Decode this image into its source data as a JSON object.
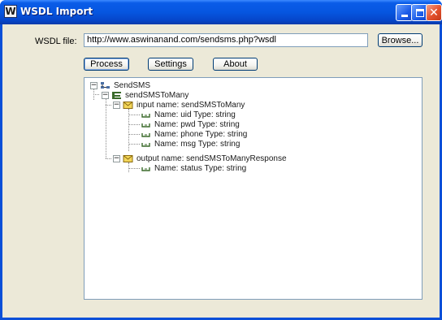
{
  "window": {
    "title": "WSDL Import",
    "app_icon_glyph": "W",
    "controls": [
      "minimize-icon",
      "maximize-icon",
      "close-icon"
    ]
  },
  "form": {
    "wsdl_label": "WSDL file:",
    "wsdl_value": "http://www.aswinanand.com/sendsms.php?wsdl",
    "browse_label": "Browse..."
  },
  "toolbar": {
    "process_label": "Process",
    "settings_label": "Settings",
    "about_label": "About"
  },
  "tree": {
    "root": {
      "label": "SendSMS",
      "icon": "service-icon",
      "expanded": true
    },
    "operation": {
      "label": "sendSMSToMany",
      "icon": "operation-icon",
      "expanded": true
    },
    "input": {
      "label": "input name: sendSMSToMany",
      "icon": "message-icon",
      "expanded": true
    },
    "input_params": [
      {
        "label": "Name: uid Type: string",
        "icon": "param-icon"
      },
      {
        "label": "Name: pwd Type: string",
        "icon": "param-icon"
      },
      {
        "label": "Name: phone Type: string",
        "icon": "param-icon"
      },
      {
        "label": "Name: msg Type: string",
        "icon": "param-icon"
      }
    ],
    "output": {
      "label": "output name: sendSMSToManyResponse",
      "icon": "message-icon",
      "expanded": true
    },
    "output_params": [
      {
        "label": "Name: status Type: string",
        "icon": "param-icon"
      }
    ]
  },
  "colors": {
    "titlebar": "#0656e0",
    "client_bg": "#ece9d8",
    "tree_bg": "#ffffff",
    "message_icon": "#e8c94a",
    "operation_icon": "#3a6a2a"
  }
}
